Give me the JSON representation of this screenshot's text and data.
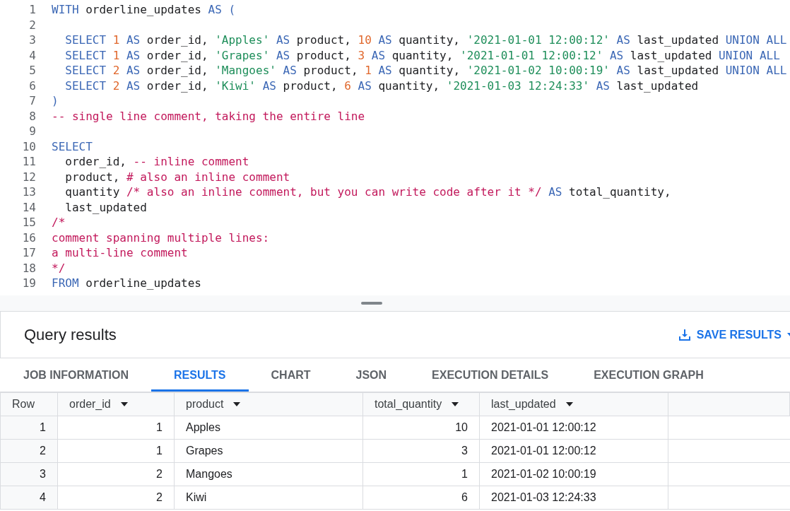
{
  "editor": {
    "lines": [
      {
        "number": "1",
        "tokens": [
          {
            "kind": "keyword",
            "text": "WITH"
          },
          {
            "kind": "plain",
            "text": " orderline_updates "
          },
          {
            "kind": "keyword",
            "text": "AS ("
          }
        ]
      },
      {
        "number": "2"
      },
      {
        "number": "3",
        "tokens": [
          {
            "kind": "keyword",
            "text": "  SELECT"
          },
          {
            "kind": "number",
            "text": " 1"
          },
          {
            "kind": "keyword",
            "text": " AS"
          },
          {
            "kind": "plain",
            "text": " order_id, "
          },
          {
            "kind": "string",
            "text": "'Apples'"
          },
          {
            "kind": "keyword",
            "text": " AS"
          },
          {
            "kind": "plain",
            "text": " product, "
          },
          {
            "kind": "number",
            "text": "10"
          },
          {
            "kind": "keyword",
            "text": " AS"
          },
          {
            "kind": "plain",
            "text": " quantity, "
          },
          {
            "kind": "string",
            "text": "'2021-01-01 12:00:12'"
          },
          {
            "kind": "keyword",
            "text": " AS"
          },
          {
            "kind": "plain",
            "text": " last_updated "
          },
          {
            "kind": "keyword",
            "text": "UNION ALL"
          }
        ]
      },
      {
        "number": "4",
        "tokens": [
          {
            "kind": "keyword",
            "text": "  SELECT"
          },
          {
            "kind": "number",
            "text": " 1"
          },
          {
            "kind": "keyword",
            "text": " AS"
          },
          {
            "kind": "plain",
            "text": " order_id, "
          },
          {
            "kind": "string",
            "text": "'Grapes'"
          },
          {
            "kind": "keyword",
            "text": " AS"
          },
          {
            "kind": "plain",
            "text": " product, "
          },
          {
            "kind": "number",
            "text": "3"
          },
          {
            "kind": "keyword",
            "text": " AS"
          },
          {
            "kind": "plain",
            "text": " quantity, "
          },
          {
            "kind": "string",
            "text": "'2021-01-01 12:00:12'"
          },
          {
            "kind": "keyword",
            "text": " AS"
          },
          {
            "kind": "plain",
            "text": " last_updated "
          },
          {
            "kind": "keyword",
            "text": "UNION ALL"
          }
        ]
      },
      {
        "number": "5",
        "tokens": [
          {
            "kind": "keyword",
            "text": "  SELECT"
          },
          {
            "kind": "number",
            "text": " 2"
          },
          {
            "kind": "keyword",
            "text": " AS"
          },
          {
            "kind": "plain",
            "text": " order_id, "
          },
          {
            "kind": "string",
            "text": "'Mangoes'"
          },
          {
            "kind": "keyword",
            "text": " AS"
          },
          {
            "kind": "plain",
            "text": " product, "
          },
          {
            "kind": "number",
            "text": "1"
          },
          {
            "kind": "keyword",
            "text": " AS"
          },
          {
            "kind": "plain",
            "text": " quantity, "
          },
          {
            "kind": "string",
            "text": "'2021-01-02 10:00:19'"
          },
          {
            "kind": "keyword",
            "text": " AS"
          },
          {
            "kind": "plain",
            "text": " last_updated "
          },
          {
            "kind": "keyword",
            "text": "UNION ALL"
          }
        ]
      },
      {
        "number": "6",
        "tokens": [
          {
            "kind": "keyword",
            "text": "  SELECT"
          },
          {
            "kind": "number",
            "text": " 2"
          },
          {
            "kind": "keyword",
            "text": " AS"
          },
          {
            "kind": "plain",
            "text": " order_id, "
          },
          {
            "kind": "string",
            "text": "'Kiwi'"
          },
          {
            "kind": "keyword",
            "text": " AS"
          },
          {
            "kind": "plain",
            "text": " product, "
          },
          {
            "kind": "number",
            "text": "6"
          },
          {
            "kind": "keyword",
            "text": " AS"
          },
          {
            "kind": "plain",
            "text": " quantity, "
          },
          {
            "kind": "string",
            "text": "'2021-01-03 12:24:33'"
          },
          {
            "kind": "keyword",
            "text": " AS"
          },
          {
            "kind": "plain",
            "text": " last_updated"
          }
        ]
      },
      {
        "number": "7",
        "tokens": [
          {
            "kind": "keyword",
            "text": ")"
          }
        ]
      },
      {
        "number": "8",
        "tokens": [
          {
            "kind": "comment",
            "text": "-- single line comment, taking the entire line"
          }
        ]
      },
      {
        "number": "9"
      },
      {
        "number": "10",
        "tokens": [
          {
            "kind": "keyword",
            "text": "SELECT"
          }
        ]
      },
      {
        "number": "11",
        "tokens": [
          {
            "kind": "plain",
            "text": "  order_id, "
          },
          {
            "kind": "comment",
            "text": "-- inline comment"
          }
        ]
      },
      {
        "number": "12",
        "tokens": [
          {
            "kind": "plain",
            "text": "  product, "
          },
          {
            "kind": "comment",
            "text": "# also an inline comment"
          }
        ]
      },
      {
        "number": "13",
        "tokens": [
          {
            "kind": "plain",
            "text": "  quantity "
          },
          {
            "kind": "comment",
            "text": "/* also an inline comment, but you can write code after it */"
          },
          {
            "kind": "keyword",
            "text": " AS"
          },
          {
            "kind": "plain",
            "text": " total_quantity,"
          }
        ]
      },
      {
        "number": "14",
        "tokens": [
          {
            "kind": "plain",
            "text": "  last_updated"
          }
        ]
      },
      {
        "number": "15",
        "tokens": [
          {
            "kind": "comment",
            "text": "/*"
          }
        ]
      },
      {
        "number": "16",
        "tokens": [
          {
            "kind": "comment",
            "text": "comment spanning multiple lines:"
          }
        ]
      },
      {
        "number": "17",
        "tokens": [
          {
            "kind": "comment",
            "text": "a multi-line comment"
          }
        ]
      },
      {
        "number": "18",
        "tokens": [
          {
            "kind": "comment",
            "text": "*/"
          }
        ]
      },
      {
        "number": "19",
        "tokens": [
          {
            "kind": "keyword",
            "text": "FROM"
          },
          {
            "kind": "plain",
            "text": " orderline_updates"
          }
        ]
      }
    ]
  },
  "results": {
    "title": "Query results",
    "save_button": "SAVE RESULTS",
    "tabs": [
      {
        "label": "JOB INFORMATION",
        "selected": false
      },
      {
        "label": "RESULTS",
        "selected": true
      },
      {
        "label": "CHART",
        "selected": false
      },
      {
        "label": "JSON",
        "selected": false
      },
      {
        "label": "EXECUTION DETAILS",
        "selected": false
      },
      {
        "label": "EXECUTION GRAPH",
        "selected": false
      }
    ],
    "table": {
      "row_header": "Row",
      "columns": [
        {
          "label": "order_id",
          "kind": "integer"
        },
        {
          "label": "product",
          "kind": "text"
        },
        {
          "label": "total_quantity",
          "kind": "integer"
        },
        {
          "label": "last_updated",
          "kind": "text"
        }
      ],
      "rows": [
        {
          "row": "1",
          "cells": [
            "1",
            "Apples",
            "10",
            "2021-01-01 12:00:12"
          ]
        },
        {
          "row": "2",
          "cells": [
            "1",
            "Grapes",
            "3",
            "2021-01-01 12:00:12"
          ]
        },
        {
          "row": "3",
          "cells": [
            "2",
            "Mangoes",
            "1",
            "2021-01-02 10:00:19"
          ]
        },
        {
          "row": "4",
          "cells": [
            "2",
            "Kiwi",
            "6",
            "2021-01-03 12:24:33"
          ]
        }
      ]
    }
  }
}
